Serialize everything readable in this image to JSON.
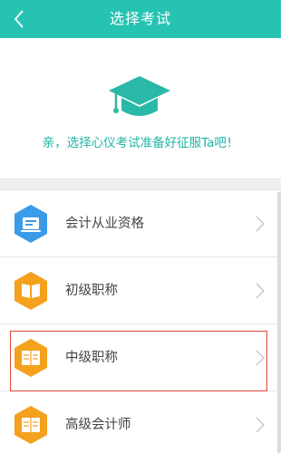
{
  "header": {
    "title": "选择考试",
    "back_icon": "chevron-left-icon"
  },
  "hero": {
    "icon": "graduation-cap-icon",
    "text": "亲，选择心仪考试准备好征服Ta吧！"
  },
  "exam_list": [
    {
      "label": "会计从业资格",
      "icon": "certificate-card-icon",
      "icon_color": "#3a9be8",
      "selected": false
    },
    {
      "label": "初级职称",
      "icon": "book-icon",
      "icon_color": "#f4a11d",
      "selected": false
    },
    {
      "label": "中级职称",
      "icon": "book-icon",
      "icon_color": "#f4a11d",
      "selected": true
    },
    {
      "label": "高级会计师",
      "icon": "book-icon",
      "icon_color": "#f4a11d",
      "selected": false
    }
  ],
  "colors": {
    "navbar": "#27c3b2",
    "accent_text": "#20b5a5",
    "selection_border": "#e0463a"
  }
}
